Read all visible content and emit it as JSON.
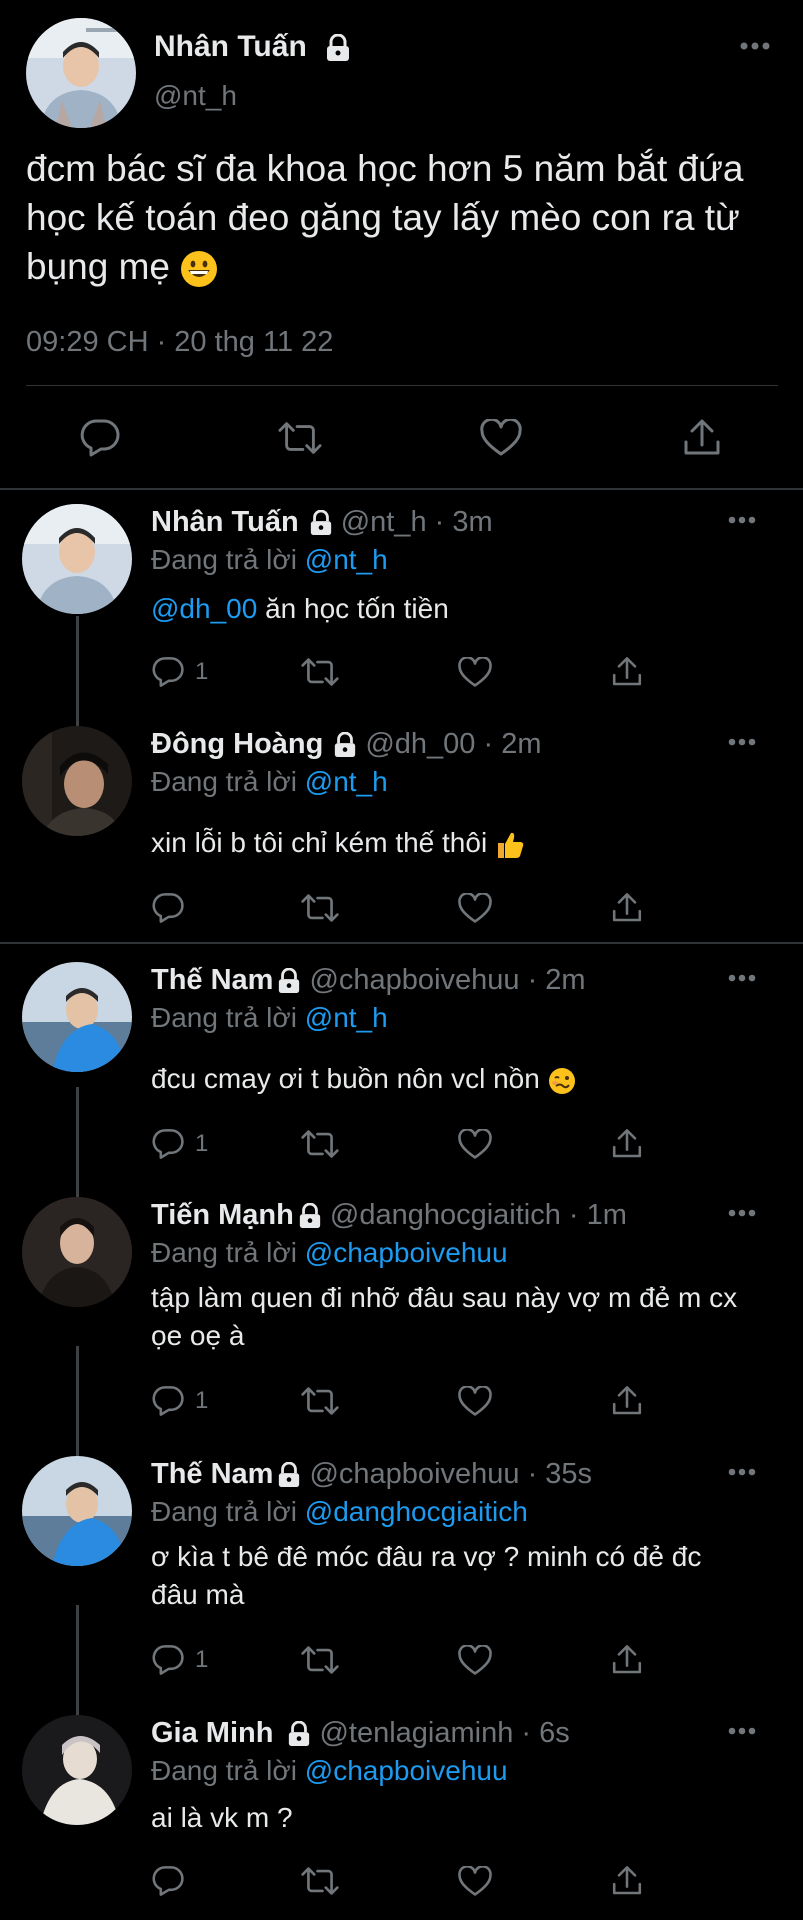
{
  "main_tweet": {
    "author_name": "Nhân Tuấn",
    "handle": "@nt_h",
    "text": "đcm bác sĩ đa khoa học hơn 5 năm bắt đứa học kế toán đeo găng tay lấy mèo con ra từ bụng mẹ",
    "emoji": "grinning-face",
    "meta": "09:29 CH · 20 thg 11 22",
    "actions": [
      "reply-icon",
      "retweet-icon",
      "like-icon",
      "share-icon"
    ]
  },
  "reply_prefix": "Đang trả lời",
  "replies": [
    {
      "name": "Nhân Tuấn",
      "handle_time": "@nt_h · 3m",
      "replying_to": "@nt_h",
      "mention": "@dh_00",
      "text": "ăn học tốn tiền",
      "reply_count": "1"
    },
    {
      "name": "Đông Hoàng",
      "handle_time": "@dh_00 · 2m",
      "replying_to": "@nt_h",
      "mention": "",
      "text": "xin lỗi b tôi chỉ kém thế thôi",
      "emoji": "thumbs-up",
      "reply_count": ""
    },
    {
      "name": "Thế Nam",
      "handle_time": "@chapboivehuu · 2m",
      "replying_to": "@nt_h",
      "mention": "",
      "text": "đcu cmay ơi t buồn nôn vcl nồn",
      "emoji": "woozy-face",
      "reply_count": "1"
    },
    {
      "name": "Tiến Mạnh",
      "handle_time": "@danghocgiaitich · 1m",
      "replying_to": "@chapboivehuu",
      "mention": "",
      "text": "tập làm quen đi nhỡ đâu sau này vợ m đẻ m cx ọe oẹ à",
      "reply_count": "1"
    },
    {
      "name": "Thế Nam",
      "handle_time": "@chapboivehuu · 35s",
      "replying_to": "@danghocgiaitich",
      "mention": "",
      "text": "ơ kìa t bê đê móc đâu ra vợ ? minh có đẻ đc đâu mà",
      "reply_count": "1"
    },
    {
      "name": "Gia Minh",
      "handle_time": "@tenlagiaminh · 6s",
      "replying_to": "@chapboivehuu",
      "mention": "",
      "text": "ai là vk m ?",
      "reply_count": ""
    }
  ],
  "colors": {
    "background": "#000000",
    "text": "#e7e9ea",
    "muted": "#71767b",
    "link": "#1d9bf0",
    "divider": "#2f3336"
  }
}
